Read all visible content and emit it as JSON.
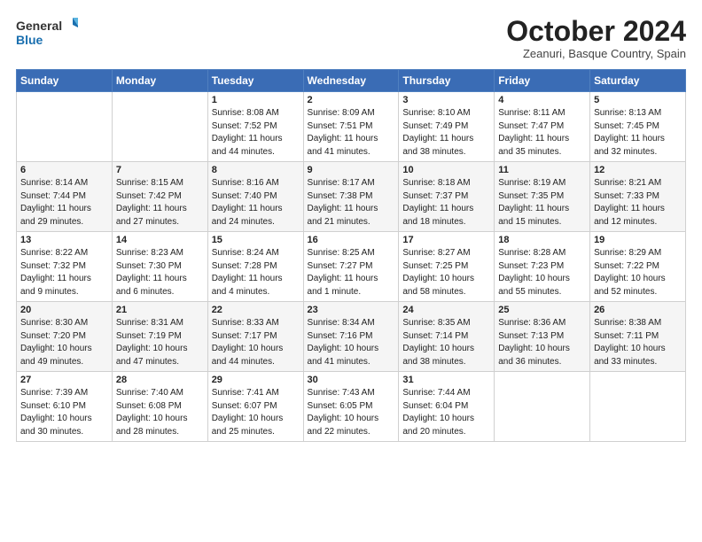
{
  "logo": {
    "line1": "General",
    "line2": "Blue"
  },
  "title": "October 2024",
  "subtitle": "Zeanuri, Basque Country, Spain",
  "days_of_week": [
    "Sunday",
    "Monday",
    "Tuesday",
    "Wednesday",
    "Thursday",
    "Friday",
    "Saturday"
  ],
  "weeks": [
    [
      {
        "day": "",
        "content": ""
      },
      {
        "day": "",
        "content": ""
      },
      {
        "day": "1",
        "content": "Sunrise: 8:08 AM\nSunset: 7:52 PM\nDaylight: 11 hours and 44 minutes."
      },
      {
        "day": "2",
        "content": "Sunrise: 8:09 AM\nSunset: 7:51 PM\nDaylight: 11 hours and 41 minutes."
      },
      {
        "day": "3",
        "content": "Sunrise: 8:10 AM\nSunset: 7:49 PM\nDaylight: 11 hours and 38 minutes."
      },
      {
        "day": "4",
        "content": "Sunrise: 8:11 AM\nSunset: 7:47 PM\nDaylight: 11 hours and 35 minutes."
      },
      {
        "day": "5",
        "content": "Sunrise: 8:13 AM\nSunset: 7:45 PM\nDaylight: 11 hours and 32 minutes."
      }
    ],
    [
      {
        "day": "6",
        "content": "Sunrise: 8:14 AM\nSunset: 7:44 PM\nDaylight: 11 hours and 29 minutes."
      },
      {
        "day": "7",
        "content": "Sunrise: 8:15 AM\nSunset: 7:42 PM\nDaylight: 11 hours and 27 minutes."
      },
      {
        "day": "8",
        "content": "Sunrise: 8:16 AM\nSunset: 7:40 PM\nDaylight: 11 hours and 24 minutes."
      },
      {
        "day": "9",
        "content": "Sunrise: 8:17 AM\nSunset: 7:38 PM\nDaylight: 11 hours and 21 minutes."
      },
      {
        "day": "10",
        "content": "Sunrise: 8:18 AM\nSunset: 7:37 PM\nDaylight: 11 hours and 18 minutes."
      },
      {
        "day": "11",
        "content": "Sunrise: 8:19 AM\nSunset: 7:35 PM\nDaylight: 11 hours and 15 minutes."
      },
      {
        "day": "12",
        "content": "Sunrise: 8:21 AM\nSunset: 7:33 PM\nDaylight: 11 hours and 12 minutes."
      }
    ],
    [
      {
        "day": "13",
        "content": "Sunrise: 8:22 AM\nSunset: 7:32 PM\nDaylight: 11 hours and 9 minutes."
      },
      {
        "day": "14",
        "content": "Sunrise: 8:23 AM\nSunset: 7:30 PM\nDaylight: 11 hours and 6 minutes."
      },
      {
        "day": "15",
        "content": "Sunrise: 8:24 AM\nSunset: 7:28 PM\nDaylight: 11 hours and 4 minutes."
      },
      {
        "day": "16",
        "content": "Sunrise: 8:25 AM\nSunset: 7:27 PM\nDaylight: 11 hours and 1 minute."
      },
      {
        "day": "17",
        "content": "Sunrise: 8:27 AM\nSunset: 7:25 PM\nDaylight: 10 hours and 58 minutes."
      },
      {
        "day": "18",
        "content": "Sunrise: 8:28 AM\nSunset: 7:23 PM\nDaylight: 10 hours and 55 minutes."
      },
      {
        "day": "19",
        "content": "Sunrise: 8:29 AM\nSunset: 7:22 PM\nDaylight: 10 hours and 52 minutes."
      }
    ],
    [
      {
        "day": "20",
        "content": "Sunrise: 8:30 AM\nSunset: 7:20 PM\nDaylight: 10 hours and 49 minutes."
      },
      {
        "day": "21",
        "content": "Sunrise: 8:31 AM\nSunset: 7:19 PM\nDaylight: 10 hours and 47 minutes."
      },
      {
        "day": "22",
        "content": "Sunrise: 8:33 AM\nSunset: 7:17 PM\nDaylight: 10 hours and 44 minutes."
      },
      {
        "day": "23",
        "content": "Sunrise: 8:34 AM\nSunset: 7:16 PM\nDaylight: 10 hours and 41 minutes."
      },
      {
        "day": "24",
        "content": "Sunrise: 8:35 AM\nSunset: 7:14 PM\nDaylight: 10 hours and 38 minutes."
      },
      {
        "day": "25",
        "content": "Sunrise: 8:36 AM\nSunset: 7:13 PM\nDaylight: 10 hours and 36 minutes."
      },
      {
        "day": "26",
        "content": "Sunrise: 8:38 AM\nSunset: 7:11 PM\nDaylight: 10 hours and 33 minutes."
      }
    ],
    [
      {
        "day": "27",
        "content": "Sunrise: 7:39 AM\nSunset: 6:10 PM\nDaylight: 10 hours and 30 minutes."
      },
      {
        "day": "28",
        "content": "Sunrise: 7:40 AM\nSunset: 6:08 PM\nDaylight: 10 hours and 28 minutes."
      },
      {
        "day": "29",
        "content": "Sunrise: 7:41 AM\nSunset: 6:07 PM\nDaylight: 10 hours and 25 minutes."
      },
      {
        "day": "30",
        "content": "Sunrise: 7:43 AM\nSunset: 6:05 PM\nDaylight: 10 hours and 22 minutes."
      },
      {
        "day": "31",
        "content": "Sunrise: 7:44 AM\nSunset: 6:04 PM\nDaylight: 10 hours and 20 minutes."
      },
      {
        "day": "",
        "content": ""
      },
      {
        "day": "",
        "content": ""
      }
    ]
  ]
}
